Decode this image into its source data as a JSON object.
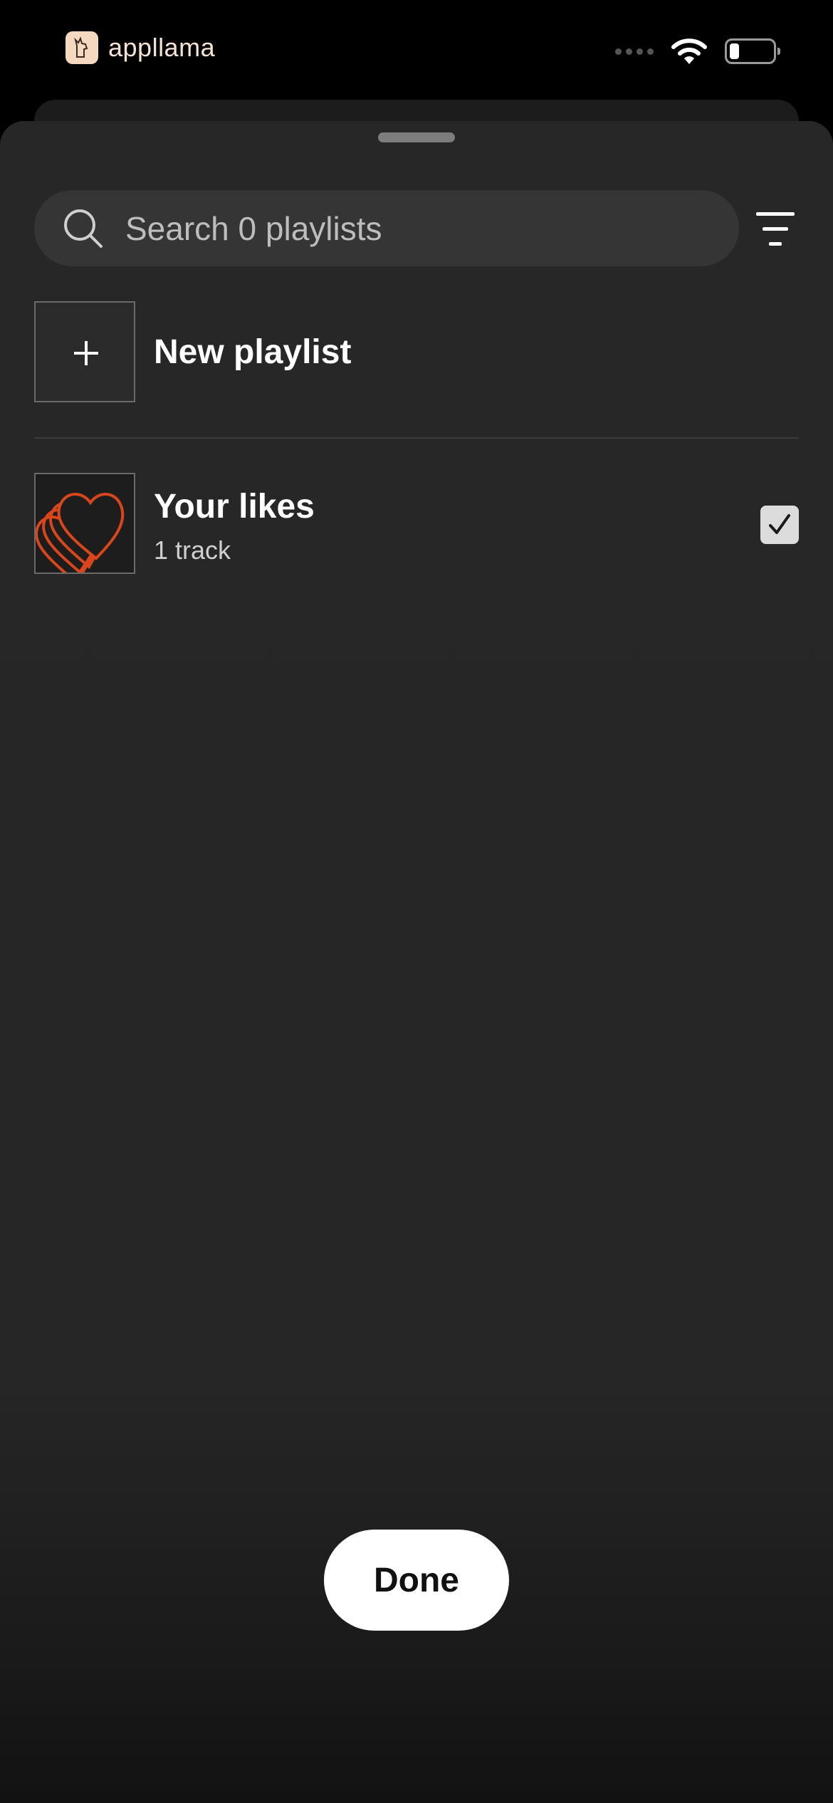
{
  "status_bar": {
    "brand_name": "appllama",
    "icons": [
      "llama-logo-icon",
      "signal-dots-icon",
      "wifi-icon",
      "battery-icon"
    ]
  },
  "sheet": {
    "search": {
      "placeholder": "Search 0 playlists",
      "value": ""
    },
    "sort_icon": "sort-lines-icon",
    "new_playlist": {
      "label": "New playlist",
      "icon": "plus-icon"
    },
    "playlists": [
      {
        "title": "Your likes",
        "subtitle": "1 track",
        "checked": true,
        "icon": "heart-stack-icon"
      }
    ],
    "done_label": "Done"
  },
  "colors": {
    "background": "#000000",
    "sheet": "#272727",
    "search_field": "#353535",
    "accent_heart": "#d9461b",
    "button": "#ffffff"
  }
}
